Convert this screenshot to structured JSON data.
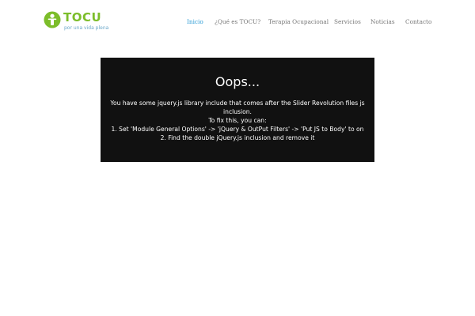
{
  "brand": {
    "name": "TOCU",
    "tagline": "por una vida plena",
    "colors": {
      "green": "#7cbd2a",
      "blue": "#6aa7c9"
    }
  },
  "nav": {
    "items": [
      {
        "label": "Inicio",
        "active": true
      },
      {
        "label": "¿Qué es TOCU?"
      },
      {
        "label": "Terapia Ocupacional"
      },
      {
        "label": "Servicios"
      },
      {
        "label": "Noticias"
      },
      {
        "label": "Contacto"
      }
    ],
    "active_color": "#2a9bd5"
  },
  "error": {
    "title": "Oops...",
    "lines": [
      "You have some jquery.js library include that comes after the Slider Revolution files js",
      "inclusion.",
      "To fix this, you can:",
      "1. Set 'Module General Options' -> 'jQuery & OutPut Filters' -> 'Put JS to Body' to on",
      "2. Find the double jQuery.js inclusion and remove it"
    ]
  }
}
